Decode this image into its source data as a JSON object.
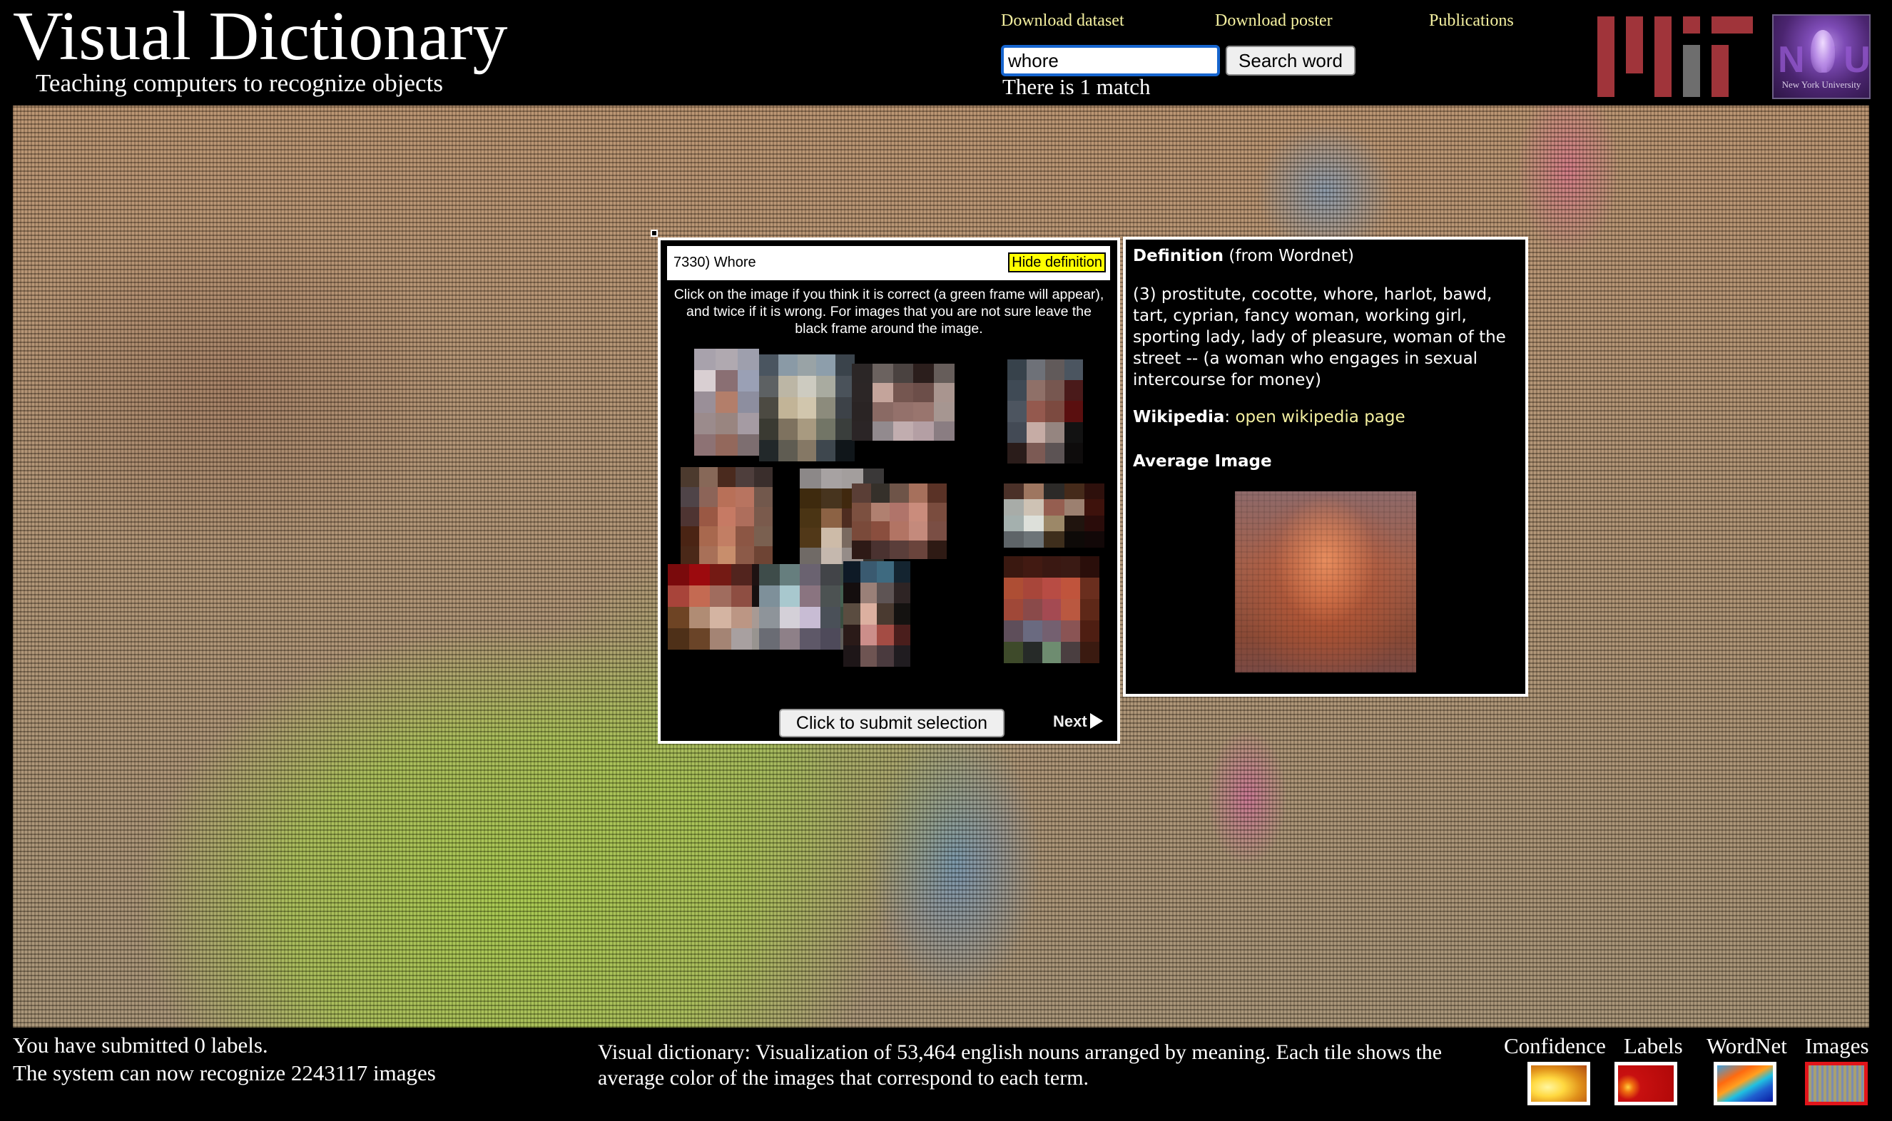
{
  "header": {
    "title": "Visual Dictionary",
    "subtitle": "Teaching computers to recognize objects",
    "links": [
      {
        "label": "Download dataset"
      },
      {
        "label": "Download poster"
      },
      {
        "label": "Publications"
      }
    ],
    "search": {
      "value": "whore",
      "button_label": "Search word",
      "match_text": "There is 1 match"
    },
    "logos": {
      "mit": "MIT",
      "nyu_caption": "New York University",
      "nyu_letters": "NYU"
    }
  },
  "popup": {
    "title": "7330) Whore",
    "hide_definition_label": "Hide definition",
    "instructions": "Click on the image if you think it is correct (a green frame will appear), and twice if it is wrong. For images that you are not sure leave the black frame around the image.",
    "thumbnails": [
      {
        "cols": 3,
        "rows": 5,
        "colors": [
          "#a8a2ac",
          "#b0a9b0",
          "#9e9fad",
          "#d9cfd2",
          "#8a6f73",
          "#9aa0b5",
          "#9a8f98",
          "#b37e6a",
          "#8d8e9f",
          "#9b8b8c",
          "#998580",
          "#a59ba3",
          "#8d7274",
          "#93685c",
          "#7d6e70"
        ]
      },
      {
        "cols": 5,
        "rows": 5,
        "colors": [
          "#4a5560",
          "#8a9aa6",
          "#99a3a6",
          "#8d9eab",
          "#3a434b",
          "#5d6163",
          "#bcb6a5",
          "#cdcbc0",
          "#a9aba0",
          "#4a525a",
          "#4c4a42",
          "#c2b497",
          "#d1c6ad",
          "#8c8b7c",
          "#3d4248",
          "#3a3a32",
          "#7e725f",
          "#a89a80",
          "#727566",
          "#3a3e3c",
          "#22282a",
          "#5f5c52",
          "#857865",
          "#3e474e",
          "#10161a"
        ]
      },
      {
        "cols": 5,
        "rows": 4,
        "colors": [
          "#2b2626",
          "#6b625f",
          "#4a4240",
          "#2b1e1c",
          "#665d5a",
          "#2c2626",
          "#c4a49b",
          "#755650",
          "#6c4e49",
          "#a9958f",
          "#2a2424",
          "#8a6a64",
          "#94716b",
          "#99756e",
          "#a69691",
          "#2b2526",
          "#928a8e",
          "#c1adaf",
          "#b49fa4",
          "#8a7d82"
        ]
      },
      {
        "cols": 4,
        "rows": 5,
        "colors": [
          "#37424b",
          "#6e7178",
          "#615a5a",
          "#4b5560",
          "#3f4a55",
          "#8f7068",
          "#775750",
          "#4a1a1a",
          "#4d5560",
          "#94594e",
          "#7c4a40",
          "#5a0f0f",
          "#434a55",
          "#c6aca5",
          "#958580",
          "#121212",
          "#2a1c1a",
          "#7c5a54",
          "#5c5354",
          "#0e0c0c"
        ]
      },
      {
        "cols": 5,
        "rows": 5,
        "colors": [
          "#4c3a2e",
          "#876858",
          "#4a2a1e",
          "#4e3e3c",
          "#3a2e2c",
          "#4f4448",
          "#8c6458",
          "#b87058",
          "#b87460",
          "#72584c",
          "#4e3432",
          "#9a5844",
          "#c67a64",
          "#ae6e5c",
          "#7a5a4c",
          "#4a2414",
          "#a8684e",
          "#c27e64",
          "#8c5644",
          "#7a6050",
          "#4a2818",
          "#a87058",
          "#c88e6c",
          "#8c5a48",
          "#6e4434"
        ]
      },
      {
        "cols": 4,
        "rows": 5,
        "colors": [
          "#8c8888",
          "#a7a2a2",
          "#a39e9d",
          "#3a3838",
          "#3e2a0e",
          "#47341e",
          "#40280e",
          "#050303",
          "#4a3414",
          "#8c6244",
          "#4e2c20",
          "#050303",
          "#513818",
          "#cdbba8",
          "#7a6a60",
          "#140606",
          "#706a66",
          "#c5b8ae",
          "#958c88",
          "#35332f"
        ]
      },
      {
        "cols": 5,
        "rows": 4,
        "colors": [
          "#5a3e36",
          "#35302a",
          "#6e5448",
          "#a6705c",
          "#5a3226",
          "#7c5040",
          "#b08070",
          "#b0746a",
          "#ca8c7c",
          "#7a4c3e",
          "#7a4a3a",
          "#8a4e3e",
          "#b27464",
          "#c48a7c",
          "#7a4e44",
          "#2e1a16",
          "#4a3230",
          "#5a3e3a",
          "#6a443c",
          "#2e1a14"
        ]
      },
      {
        "cols": 5,
        "rows": 5,
        "colors": [
          "#4a3028",
          "#9e7660",
          "#2c2a28",
          "#452a1a",
          "#2e100c",
          "#a8aca8",
          "#cec2b4",
          "#955e50",
          "#9c8070",
          "#3e120c",
          "#a4b0ae",
          "#dde0da",
          "#9c8868",
          "#20140e",
          "#2a0c0a",
          "#5e6468",
          "#6d7478",
          "#3e2e1c",
          "#0e0a08",
          "#120808",
          "#000000",
          "#000000",
          "#000000",
          "#000000",
          "#000000"
        ]
      },
      {
        "cols": 5,
        "rows": 4,
        "colors": [
          "#7a0a0c",
          "#9c0a0e",
          "#741a14",
          "#52241e",
          "#1e1212",
          "#a8443a",
          "#c46a52",
          "#a06c5e",
          "#8e4e42",
          "#161010",
          "#6e4424",
          "#b08c74",
          "#d4b4a2",
          "#bc9684",
          "#a89a94",
          "#4e3018",
          "#6a4428",
          "#a48474",
          "#a8a0a0",
          "#989490"
        ]
      },
      {
        "cols": 5,
        "rows": 4,
        "colors": [
          "#3e4c4a",
          "#667e7e",
          "#6a6270",
          "#424448",
          "#3e4a44",
          "#7e909a",
          "#a8c8ce",
          "#8a7480",
          "#4c5252",
          "#446050",
          "#8e949a",
          "#d4d0d8",
          "#c8bcd4",
          "#4a5058",
          "#3a4e40",
          "#6a6c74",
          "#8e8088",
          "#5e5868",
          "#4e4a5a",
          "#5e5c58"
        ]
      },
      {
        "cols": 4,
        "rows": 5,
        "colors": [
          "#0e1a26",
          "#3a5a70",
          "#3e6a80",
          "#142430",
          "#140e0e",
          "#9a8078",
          "#5e5454",
          "#2e2424",
          "#5a4c40",
          "#dcb0a0",
          "#4a3a30",
          "#141210",
          "#2a1a18",
          "#cc8e8a",
          "#a44c44",
          "#4a1e1c",
          "#1e1618",
          "#6e5452",
          "#4a3a3e",
          "#201c20"
        ]
      },
      {
        "cols": 5,
        "rows": 5,
        "colors": [
          "#3a1810",
          "#421a12",
          "#3a1812",
          "#3a1a14",
          "#2a0e0a",
          "#ae4e34",
          "#a8463a",
          "#b84c44",
          "#c0543c",
          "#6a2e1e",
          "#a04838",
          "#8a4a4a",
          "#a44a52",
          "#ba5840",
          "#5e2818",
          "#5e4e5a",
          "#6a6a80",
          "#746070",
          "#8a5454",
          "#4e1e12",
          "#3e4a2a",
          "#262a28",
          "#6e8c70",
          "#4a3e40",
          "#3a1a10"
        ]
      }
    ],
    "submit_label": "Click to submit selection",
    "next_label": "Next"
  },
  "definition": {
    "heading_bold": "Definition",
    "heading_rest": " (from Wordnet)",
    "text": "(3) prostitute, cocotte, whore, harlot, bawd, tart, cyprian, fancy woman, working girl, sporting lady, lady of pleasure, woman of the street -- (a woman who engages in sexual intercourse for money)",
    "wikipedia_label": "Wikipedia",
    "wikipedia_link": "open wikipedia page",
    "average_image_heading": "Average Image"
  },
  "footer": {
    "submitted": "You have submitted 0 labels.",
    "recognize": "The system can now recognize 2243117 images",
    "description": "Visual dictionary: Visualization of 53,464 english nouns arranged by meaning. Each tile shows the average color of the images that correspond to each term.",
    "views": [
      {
        "label": "Confidence",
        "active": false
      },
      {
        "label": "Labels",
        "active": false
      },
      {
        "label": "WordNet",
        "active": false
      },
      {
        "label": "Images",
        "active": true
      }
    ]
  },
  "colors": {
    "link": "#f4f0a0",
    "highlight": "#ffff00",
    "active_view_border": "#e1141a",
    "mit_red": "#a0343a",
    "mit_gray": "#6e6e6e"
  }
}
